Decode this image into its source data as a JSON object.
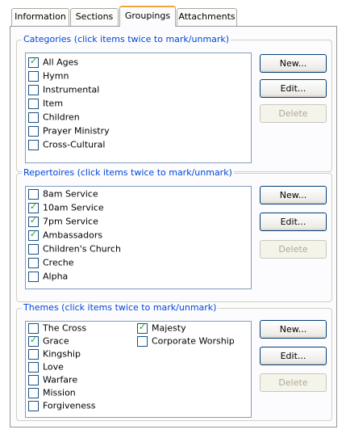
{
  "tabs": [
    {
      "label": "Information"
    },
    {
      "label": "Sections"
    },
    {
      "label": "Groupings",
      "active": true
    },
    {
      "label": "Attachments"
    }
  ],
  "categories": {
    "title": "Categories (click items twice to mark/unmark)",
    "items": [
      {
        "label": "All Ages",
        "checked": true
      },
      {
        "label": "Hymn",
        "checked": false
      },
      {
        "label": "Instrumental",
        "checked": false
      },
      {
        "label": "Item",
        "checked": false
      },
      {
        "label": "Children",
        "checked": false
      },
      {
        "label": "Prayer Ministry",
        "checked": false
      },
      {
        "label": "Cross-Cultural",
        "checked": false
      }
    ],
    "buttons": {
      "new": "New...",
      "edit": "Edit...",
      "delete": "Delete"
    }
  },
  "repertoires": {
    "title": "Repertoires (click items twice to mark/unmark)",
    "items": [
      {
        "label": "8am Service",
        "checked": false
      },
      {
        "label": "10am Service",
        "checked": true
      },
      {
        "label": "7pm Service",
        "checked": true
      },
      {
        "label": "Ambassadors",
        "checked": true
      },
      {
        "label": "Children's Church",
        "checked": false
      },
      {
        "label": "Creche",
        "checked": false
      },
      {
        "label": "Alpha",
        "checked": false
      }
    ],
    "buttons": {
      "new": "New...",
      "edit": "Edit...",
      "delete": "Delete"
    }
  },
  "themes": {
    "title": "Themes (click items twice to mark/unmark)",
    "items": [
      {
        "label": "The Cross",
        "checked": false
      },
      {
        "label": "Grace",
        "checked": true
      },
      {
        "label": "Kingship",
        "checked": false
      },
      {
        "label": "Love",
        "checked": false
      },
      {
        "label": "Warfare",
        "checked": false
      },
      {
        "label": "Mission",
        "checked": false
      },
      {
        "label": "Forgiveness",
        "checked": false
      },
      {
        "label": "Majesty",
        "checked": true
      },
      {
        "label": "Corporate Worship",
        "checked": false
      }
    ],
    "buttons": {
      "new": "New...",
      "edit": "Edit...",
      "delete": "Delete"
    }
  },
  "icons": {
    "checkmark": "checkmark-icon"
  },
  "colors": {
    "group_title": "#0046d5",
    "checkmark": "#21a121",
    "active_tab_accent": "#f2a63a"
  }
}
